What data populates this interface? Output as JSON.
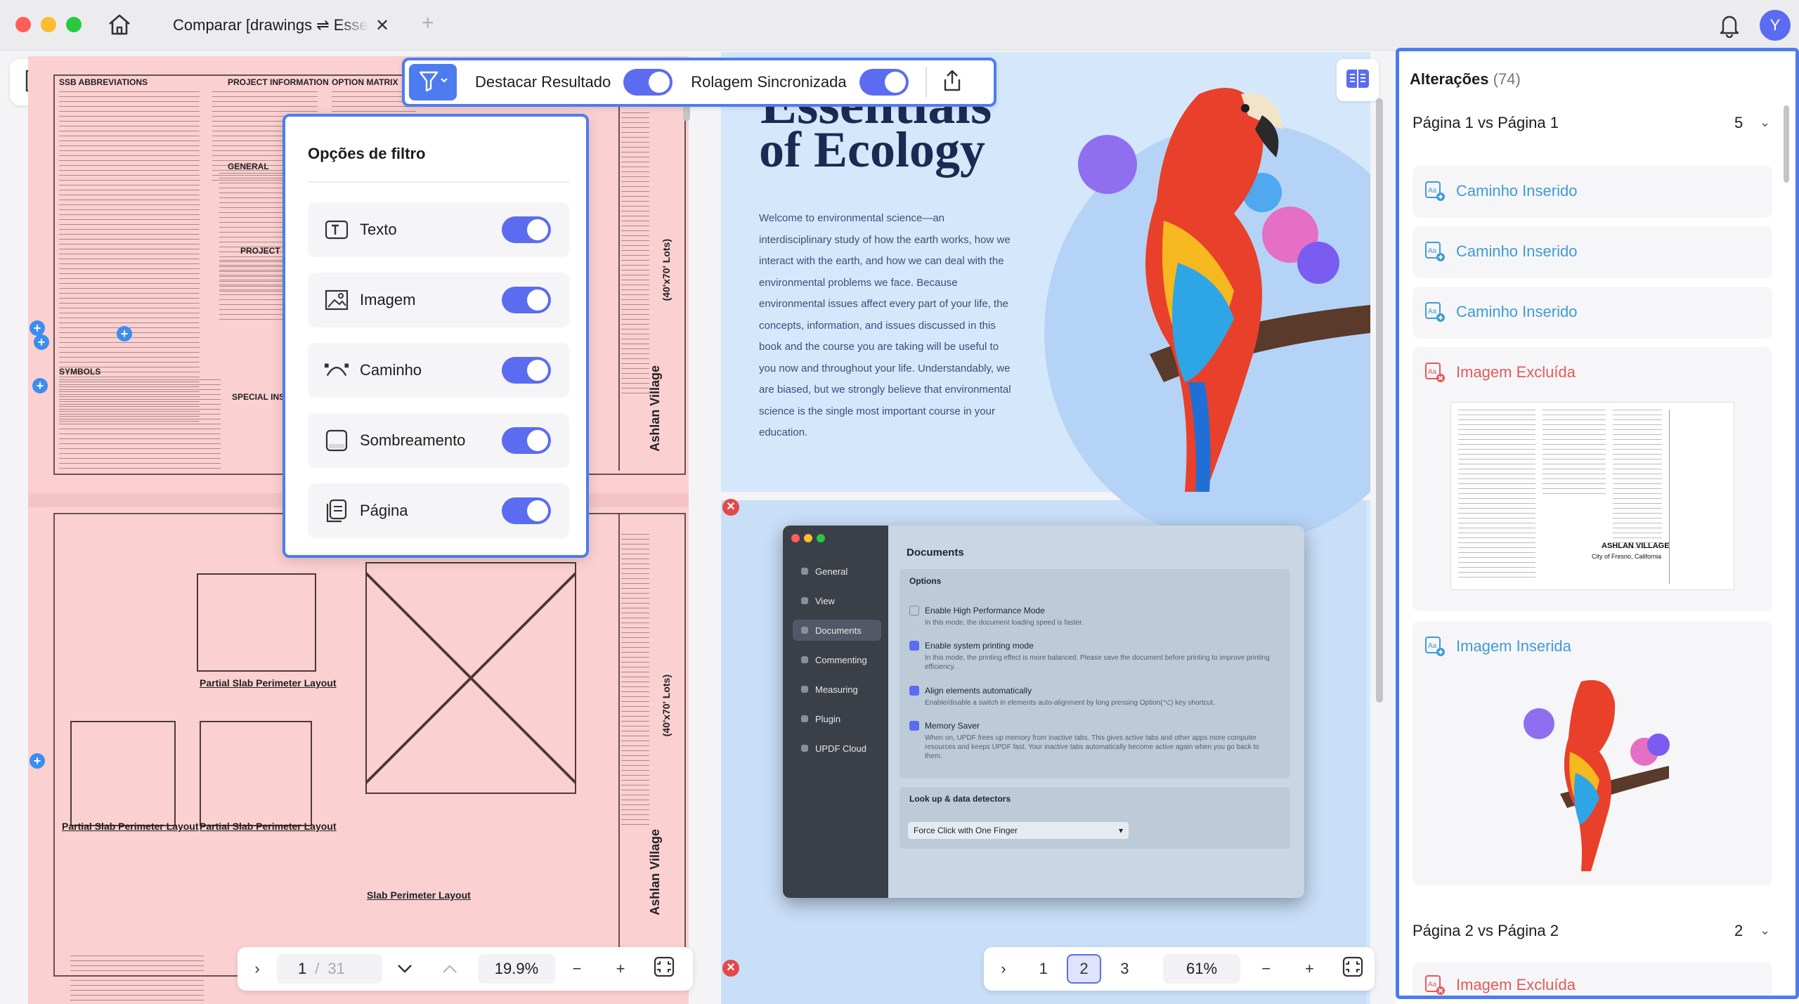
{
  "window": {
    "tab_title": "Comparar [drawings ⇌ Essentials of Ecology]",
    "new_tab_symbol": "+",
    "close_symbol": "✕",
    "avatar_initial": "Y"
  },
  "toolbar": {
    "highlight_label": "Destacar Resultado",
    "sync_scroll_label": "Rolagem Sincronizada"
  },
  "filter_popup": {
    "title": "Opções de filtro",
    "items": [
      {
        "label": "Texto",
        "icon": "text-icon",
        "enabled": true
      },
      {
        "label": "Imagem",
        "icon": "image-icon",
        "enabled": true
      },
      {
        "label": "Caminho",
        "icon": "path-icon",
        "enabled": true
      },
      {
        "label": "Sombreamento",
        "icon": "shading-icon",
        "enabled": true
      },
      {
        "label": "Página",
        "icon": "page-icon",
        "enabled": true
      }
    ]
  },
  "left_doc": {
    "headers": [
      "SSB ABBREVIATIONS",
      "PROJECT INFORMATION",
      "OPTION MATRIX",
      "GENERAL",
      "PROJECT T",
      "SYMBOLS",
      "SPECIAL INSP"
    ],
    "vertical_labels": [
      "Ashlan Village",
      "(40'x70' Lots)"
    ],
    "plan_labels": [
      "Partial Slab Perimeter Layout",
      "Partial Slab Perimeter Layout",
      "Partial Slab Perimeter Layout",
      "Slab Perimeter Layout"
    ],
    "pagination": {
      "current": "1",
      "separator": "/",
      "total": "31",
      "zoom": "19.9%"
    }
  },
  "right_doc": {
    "heading_line1": "Essentials",
    "heading_line2": "of Ecology",
    "paragraph": "Welcome to environmental science—an interdisciplinary study of how the earth works, how we interact with the earth, and how we can deal with the environmental problems we face. Because environmental issues affect every part of your life, the concepts, information, and issues discussed in this book and the course you are taking will be useful to you now and throughout your life. Understandably, we are biased, but we strongly believe that environmental science is the single most important course in your education.",
    "settings_window": {
      "sidebar": [
        "General",
        "View",
        "Documents",
        "Commenting",
        "Measuring",
        "Plugin",
        "UPDF Cloud"
      ],
      "active": "Documents",
      "title": "Documents",
      "options_label": "Options",
      "options": [
        {
          "label": "Enable High Performance Mode",
          "desc": "In this mode, the document loading speed is faster.",
          "checked": false
        },
        {
          "label": "Enable system printing mode",
          "desc": "In this mode, the printing effect is more balanced. Please save the document before printing to improve printing efficiency.",
          "checked": true
        },
        {
          "label": "Align elements automatically",
          "desc": "Enable/disable a switch in elements auto-alignment by long pressing Option(⌥) key shortcut.",
          "checked": true
        },
        {
          "label": "Memory Saver",
          "desc": "When on, UPDF frees up memory from inactive tabs. This gives active tabs and other apps more computer resources and keeps UPDF fast. Your inactive tabs automatically become active again when you go back to them.",
          "checked": true
        }
      ],
      "lookup_label": "Look up & data detectors",
      "lookup_value": "Force Click with One Finger"
    },
    "pagination": {
      "pages": [
        "1",
        "2",
        "3"
      ],
      "active": "2",
      "zoom": "61%"
    }
  },
  "changes_panel": {
    "title": "Alterações",
    "count": "(74)",
    "sections": [
      {
        "title": "Página 1 vs Página 1",
        "count": "5"
      },
      {
        "title": "Página 2 vs Página 2",
        "count": "2"
      }
    ],
    "items": [
      {
        "label": "Caminho Inserido",
        "type": "inserted"
      },
      {
        "label": "Caminho Inserido",
        "type": "inserted"
      },
      {
        "label": "Caminho Inserido",
        "type": "inserted"
      },
      {
        "label": "Imagem Excluída",
        "type": "deleted"
      },
      {
        "label": "Imagem Inserida",
        "type": "inserted"
      },
      {
        "label": "Imagem Excluída",
        "type": "deleted"
      }
    ],
    "thumb_labels": {
      "title": "ASHLAN VILLAGE",
      "subtitle": "City of Fresno, California"
    }
  },
  "colors": {
    "accent": "#4d7cf0",
    "toggle": "#5b6cf0",
    "deleted_bg": "#fbd0d0",
    "inserted_bg": "#d5e7fb",
    "inserted_text": "#3f9bd8",
    "deleted_text": "#e45a5a"
  }
}
